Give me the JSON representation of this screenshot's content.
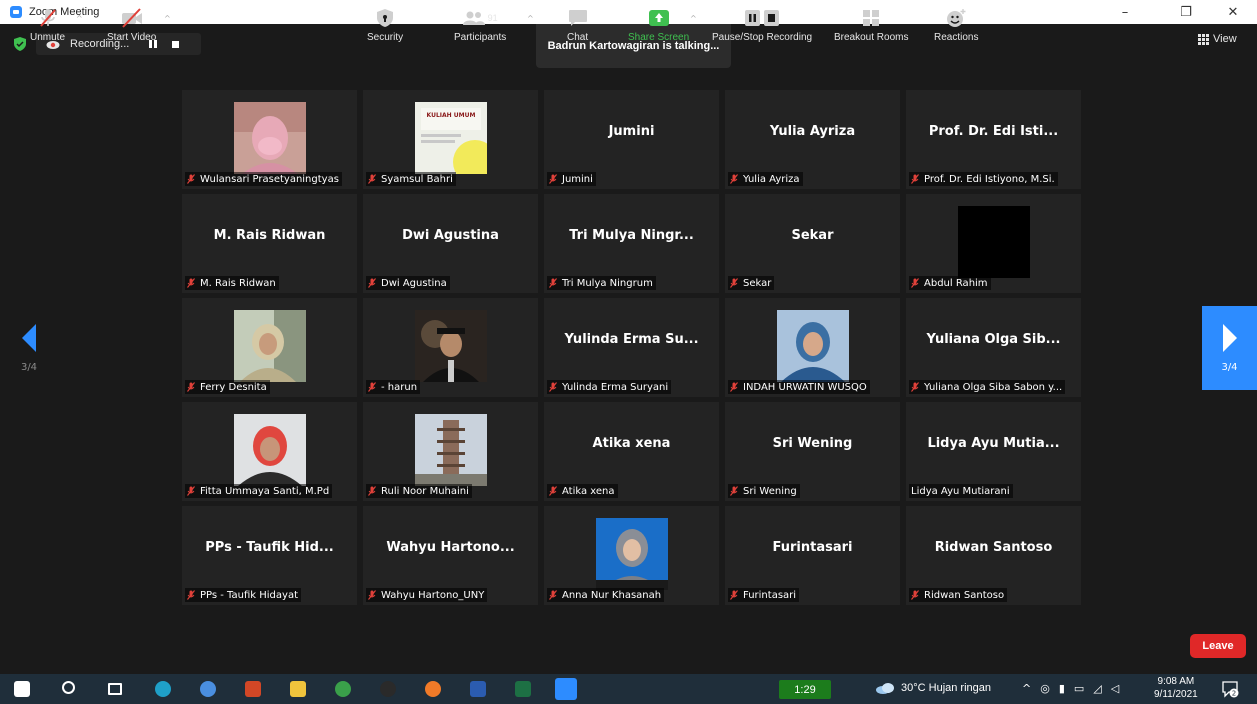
{
  "window": {
    "title": "Zoom Meeting",
    "minimize": "–",
    "restore": "❐",
    "close": "✕"
  },
  "recording": {
    "label": "Recording..."
  },
  "talking_banner": "Badrun Kartowagiran is talking...",
  "view_label": "View",
  "pagination": {
    "left": "3/4",
    "right": "3/4"
  },
  "tiles": [
    {
      "label": "Wulansari Prasetyaningtyas",
      "big": "",
      "muted": true,
      "photo": "woman-pink-mask"
    },
    {
      "label": "Syamsul Bahri",
      "big": "",
      "muted": true,
      "photo": "kuliah-umum-poster",
      "photo_text": "KULIAH UMUM"
    },
    {
      "label": "Jumini",
      "big": "Jumini",
      "muted": true
    },
    {
      "label": "Yulia Ayriza",
      "big": "Yulia Ayriza",
      "muted": true
    },
    {
      "label": "Prof. Dr. Edi Istiyono, M.Si.",
      "big": "Prof. Dr. Edi Isti...",
      "muted": true
    },
    {
      "label": "M. Rais Ridwan",
      "big": "M. Rais Ridwan",
      "muted": true
    },
    {
      "label": "Dwi Agustina",
      "big": "Dwi Agustina",
      "muted": true
    },
    {
      "label": "Tri Mulya Ningrum",
      "big": "Tri Mulya Ningr...",
      "muted": true
    },
    {
      "label": "Sekar",
      "big": "Sekar",
      "muted": true
    },
    {
      "label": "Abdul Rahim",
      "big": "",
      "muted": true,
      "photo": "black-video"
    },
    {
      "label": "Ferry Desnita",
      "big": "",
      "muted": true,
      "photo": "woman-hijab-green"
    },
    {
      "label": "- harun",
      "big": "",
      "muted": true,
      "photo": "man-graduation"
    },
    {
      "label": "Yulinda Erma Suryani",
      "big": "Yulinda Erma Su...",
      "muted": true
    },
    {
      "label": "INDAH URWATIN WUSQO",
      "big": "",
      "muted": true,
      "photo": "woman-hijab-blue"
    },
    {
      "label": "Yuliana Olga Siba Sabon y...",
      "big": "Yuliana Olga Sib...",
      "muted": true
    },
    {
      "label": "Fitta Ummaya Santi, M.Pd",
      "big": "",
      "muted": true,
      "photo": "woman-hijab-red"
    },
    {
      "label": "Ruli Noor Muhaini",
      "big": "",
      "muted": true,
      "photo": "pagoda"
    },
    {
      "label": "Atika xena",
      "big": "Atika xena",
      "muted": true
    },
    {
      "label": "Sri Wening",
      "big": "Sri Wening",
      "muted": true
    },
    {
      "label": "Lidya Ayu Mutiarani",
      "big": "Lidya Ayu Mutia...",
      "muted": false
    },
    {
      "label": "PPs - Taufik Hidayat",
      "big": "PPs - Taufik Hid...",
      "muted": true
    },
    {
      "label": "Wahyu Hartono_UNY",
      "big": "Wahyu Hartono...",
      "muted": true
    },
    {
      "label": "Anna Nur Khasanah",
      "big": "",
      "muted": true,
      "photo": "woman-hijab-grey"
    },
    {
      "label": "Furintasari",
      "big": "Furintasari",
      "muted": true
    },
    {
      "label": "Ridwan Santoso",
      "big": "Ridwan Santoso",
      "muted": true
    }
  ],
  "toolbar": {
    "unmute": "Unmute",
    "start_video": "Start Video",
    "security": "Security",
    "participants": "Participants",
    "participants_count": "91",
    "chat": "Chat",
    "share_screen": "Share Screen",
    "pause_stop_recording": "Pause/Stop Recording",
    "breakout_rooms": "Breakout Rooms",
    "reactions": "Reactions",
    "leave": "Leave"
  },
  "taskbar": {
    "timer": "1:29",
    "weather": "30°C  Hujan ringan",
    "time": "9:08 AM",
    "date": "9/11/2021",
    "notifications": "2",
    "apps": [
      "windows-start-icon",
      "search-icon",
      "task-view-icon",
      "edge-icon",
      "chrome-icon",
      "powerpoint-icon",
      "file-explorer-icon",
      "chrome-user-icon",
      "pen-app-icon",
      "firefox-icon",
      "word-icon",
      "excel-icon",
      "zoom-icon"
    ]
  },
  "colors": {
    "zoom_blue": "#2D8CFF",
    "leave_red": "#E02828",
    "mute_red": "#E0413A",
    "share_green": "#3FC050",
    "tile_bg": "#232323",
    "meeting_bg": "#1A1A1A"
  }
}
